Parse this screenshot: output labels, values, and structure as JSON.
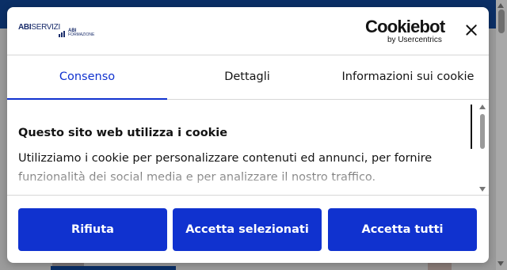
{
  "brand": {
    "site_logo_main_bold": "ABI",
    "site_logo_main": "SERVIZI",
    "site_logo_sub_bold": "ABI",
    "site_logo_sub": "FORMAZIONE",
    "cmp_logo": "Cookiebot",
    "cmp_byline": "by Usercentrics"
  },
  "tabs": [
    {
      "label": "Consenso",
      "active": true
    },
    {
      "label": "Dettagli",
      "active": false
    },
    {
      "label": "Informazioni sui cookie",
      "active": false
    }
  ],
  "content": {
    "title": "Questo sito web utilizza i cookie",
    "text": "Utilizziamo i cookie per personalizzare contenuti ed annunci, per fornire funzionalità dei social media e per analizzare il nostro traffico."
  },
  "buttons": {
    "deny": "Rifiuta",
    "allow_selected": "Accetta selezionati",
    "allow_all": "Accetta tutti"
  },
  "colors": {
    "accent": "#1032cf",
    "site_brand": "#1a2d6b",
    "overlay_background": "#9b9b9b"
  }
}
